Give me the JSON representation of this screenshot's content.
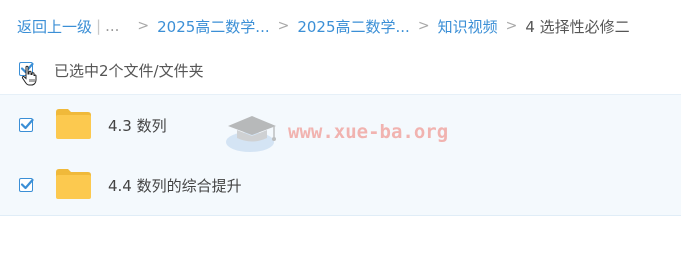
{
  "breadcrumb": {
    "back": "返回上一级",
    "ellipsis": "...",
    "items": [
      "2025高二数学...",
      "2025高二数学...",
      "知识视频"
    ],
    "current": "4 选择性必修二"
  },
  "selection": {
    "label": "已选中2个文件/文件夹",
    "all_checked": true
  },
  "files": [
    {
      "name": "4.3 数列",
      "type": "folder",
      "checked": true
    },
    {
      "name": "4.4 数列的综合提升",
      "type": "folder",
      "checked": true
    }
  ],
  "watermark": {
    "text": "www.xue-ba.org"
  },
  "colors": {
    "link": "#3b8fd6",
    "checkbox": "#3b8fd6",
    "folder": "#fcc94f",
    "row_bg": "#f4f9fd"
  }
}
